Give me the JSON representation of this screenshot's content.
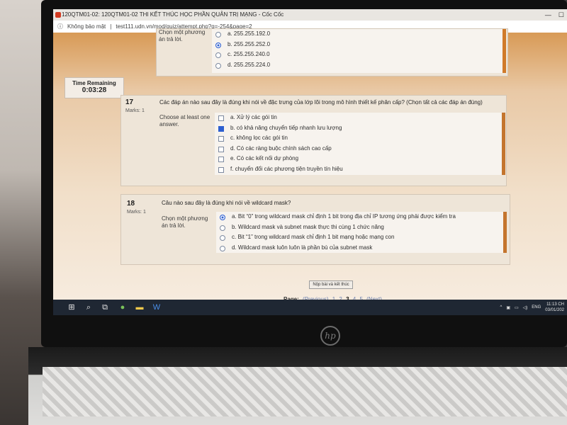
{
  "window": {
    "title": "120QTM01-02: 120QTM01-02 THI KẾT THÚC HỌC PHẦN QUẢN TRỊ MẠNG - Cốc Cốc",
    "security_label": "Không bảo mật",
    "url": "test111.udn.vn/mod/quiz/attempt.php?q=-254&page=2"
  },
  "timer": {
    "label": "Time Remaining",
    "value": "0:03:28"
  },
  "prev_question": {
    "prompt": "Chọn một phương án trả lời.",
    "options": [
      {
        "text": "a. 255.255.192.0",
        "selected": false
      },
      {
        "text": "b. 255.255.252.0",
        "selected": true
      },
      {
        "text": "c. 255.255.240.0",
        "selected": false
      },
      {
        "text": "d. 255.255.224.0",
        "selected": false
      }
    ]
  },
  "q17": {
    "number": "17",
    "marks": "Marks: 1",
    "text": "Các đáp án nào sau đây là đúng khi nói về đặc trưng của lớp lõi trong mô hình thiết kế phân cấp? (Chọn tất cả các đáp án đúng)",
    "prompt": "Choose at least one answer.",
    "options": [
      {
        "text": "a. Xử lý các gói tin",
        "checked": false
      },
      {
        "text": "b. có khả năng chuyển tiếp nhanh lưu lượng",
        "checked": true
      },
      {
        "text": "c. không lọc các gói tin",
        "checked": false
      },
      {
        "text": "d. Có các ràng buộc chính sách cao cấp",
        "checked": false
      },
      {
        "text": "e. Có các kết nối dự phòng",
        "checked": false
      },
      {
        "text": "f. chuyển đổi các phương tiện truyền tín hiệu",
        "checked": false
      }
    ]
  },
  "q18": {
    "number": "18",
    "marks": "Marks: 1",
    "text": "Câu nào sau đây là đúng khi nói về wildcard mask?",
    "prompt": "Chọn một phương án trả lời.",
    "options": [
      {
        "text": "a. Bit “0” trong wildcard mask chỉ định 1 bit trong địa chỉ IP tương ứng phải được kiểm tra",
        "selected": true
      },
      {
        "text": "b. Wildcard mask và subnet mask thực thi cùng 1 chức năng",
        "selected": false
      },
      {
        "text": "c. Bit “1” trong wildcard mask chỉ định 1 bit mạng hoặc mạng con",
        "selected": false
      },
      {
        "text": "d. Wildcard mask luôn luôn là phần bù của subnet mask",
        "selected": false
      }
    ]
  },
  "finish_button": "Nộp bài và kết thúc",
  "pager": {
    "label": "Page:",
    "previous": "(Previous)",
    "pages": [
      "1",
      "2",
      "3",
      "4",
      "5"
    ],
    "current": "3",
    "next": "(Next)"
  },
  "taskbar": {
    "lang": "ENG",
    "time": "11:13 CH",
    "date": "03/01/202"
  },
  "colors": {
    "accent_orange": "#c4752e",
    "radio_blue": "#2d5fd0"
  }
}
